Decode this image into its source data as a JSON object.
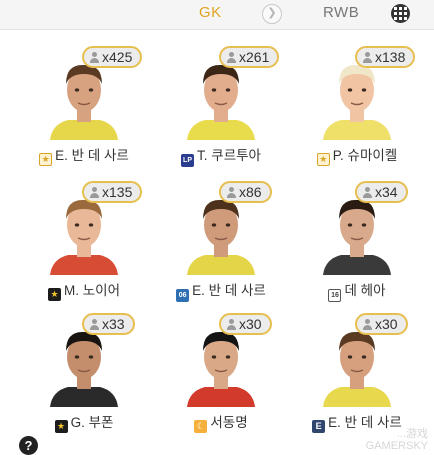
{
  "header": {
    "current_position": "GK",
    "next_position": "RWB",
    "next_icon": "chevron-right-icon",
    "menu_icon": "grid-menu-icon"
  },
  "players": [
    {
      "name": "E. 반 데 사르",
      "count": "x425",
      "tag": "★",
      "tag_style": "star-gold",
      "skin": "#d7a27f",
      "hair": "#5a3a22",
      "jersey": "#e6d64a"
    },
    {
      "name": "T. 쿠르투아",
      "count": "x261",
      "tag": "LP",
      "tag_style": "lp",
      "skin": "#e1ad8c",
      "hair": "#3c2616",
      "jersey": "#e9dc4c"
    },
    {
      "name": "P. 슈마이켈",
      "count": "x138",
      "tag": "★",
      "tag_style": "star-gold",
      "skin": "#f1c4a4",
      "hair": "#f0e6c8",
      "jersey": "#efe06a"
    },
    {
      "name": "M. 노이어",
      "count": "x135",
      "tag": "★",
      "tag_style": "star-dark",
      "skin": "#e9b898",
      "hair": "#9a6a3e",
      "jersey": "#d74c35"
    },
    {
      "name": "E. 반 데 사르",
      "count": "x86",
      "tag": "06",
      "tag_style": "n06",
      "skin": "#cf9b7b",
      "hair": "#4d311c",
      "jersey": "#e4d548"
    },
    {
      "name": "데 헤아",
      "count": "x34",
      "tag": "16",
      "tag_style": "n16",
      "skin": "#d9a98c",
      "hair": "#2a1c12",
      "jersey": "#3a3a3a"
    },
    {
      "name": "G. 부폰",
      "count": "x33",
      "tag": "★",
      "tag_style": "star-dark",
      "skin": "#c48d6b",
      "hair": "#1a1410",
      "jersey": "#2a2a2a"
    },
    {
      "name": "서동명",
      "count": "x30",
      "tag": "☾",
      "tag_style": "moon",
      "skin": "#d9a886",
      "hair": "#141414",
      "jersey": "#d23a2c"
    },
    {
      "name": "E. 반 데 사르",
      "count": "x30",
      "tag": "E",
      "tag_style": "e",
      "skin": "#d6a07e",
      "hair": "#5a3a22",
      "jersey": "#e8d84e"
    }
  ],
  "footer": {
    "help_label": "?",
    "watermark_line1": "...游戏",
    "watermark_line2": "GAMERSKY"
  }
}
